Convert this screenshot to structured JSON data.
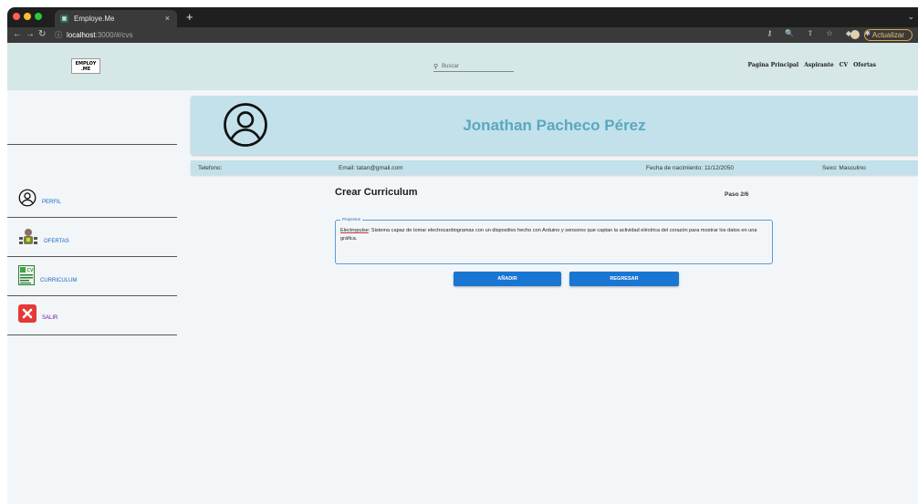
{
  "browser": {
    "tab_title": "Employe.Me",
    "tab_close": "×",
    "new_tab": "+",
    "url_host": "localhost",
    "url_path": ":3000/#/cvs",
    "update_label": "Actualizar",
    "traffic_colors": [
      "#ff5f57",
      "#febc2e",
      "#28c840"
    ]
  },
  "header": {
    "logo_line1": "EMPLOY",
    "logo_line2": ".ME",
    "search_placeholder": "Buscar",
    "nav": [
      "Pagina Principal",
      "Aspirante",
      "CV",
      "Ofertas"
    ]
  },
  "sidebar": {
    "items": [
      {
        "label": "PERFIL",
        "icon": "user-circle-icon"
      },
      {
        "label": "OFERTAS",
        "icon": "job-offers-icon"
      },
      {
        "label": "CURRICULUM",
        "icon": "cv-document-icon"
      },
      {
        "label": "SALIR",
        "icon": "exit-x-icon"
      }
    ]
  },
  "profile": {
    "name": "Jonathan Pacheco Pérez",
    "telefono": "Telefono:",
    "email": "Email: tatan@gmail.com",
    "fecha": "Fecha de nacimiento: 11/12/2050",
    "sexo": "Sexo: Masculino"
  },
  "form": {
    "title": "Crear Curriculum",
    "step": "Paso 2/6",
    "legend": "Proyectos",
    "project_name": "Electropulse",
    "project_text": ": Sistema capaz de tomar electrocardiogramas con un dispositivo hecho con Arduino y sensores que captan la actividad eléctrica del corazón para mostrar los datos en una gráfica.",
    "add_label": "AÑADIR",
    "back_label": "REGRESAR"
  },
  "colors": {
    "header_bg": "#d5e7e7",
    "banner_bg": "#c2e1ea",
    "name_color": "#5aa8bf",
    "button_bg": "#1976d2"
  }
}
